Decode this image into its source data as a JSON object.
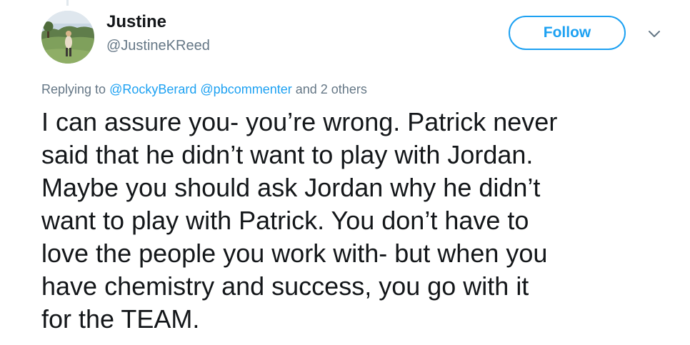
{
  "user": {
    "name": "Justine",
    "handle": "@JustineKReed"
  },
  "follow_button": {
    "label": "Follow"
  },
  "menu": {
    "icon": "chevron-down-icon"
  },
  "reply": {
    "prefix": "Replying to",
    "mention_1": "@RockyBerard",
    "mention_2": "@pbcommenter",
    "suffix": "and 2 others"
  },
  "tweet": {
    "lines": [
      "I can assure you- you’re wrong. Patrick never",
      "said that he didn’t want to play with Jordan.",
      "Maybe you should ask Jordan why he didn’t",
      "want to play with Patrick. You don’t have to",
      "love the people you work with- but when you",
      "have chemistry and success, you go with it",
      "for the TEAM."
    ]
  },
  "colors": {
    "accent": "#1da1f2",
    "text": "#14171a",
    "muted": "#657786"
  }
}
